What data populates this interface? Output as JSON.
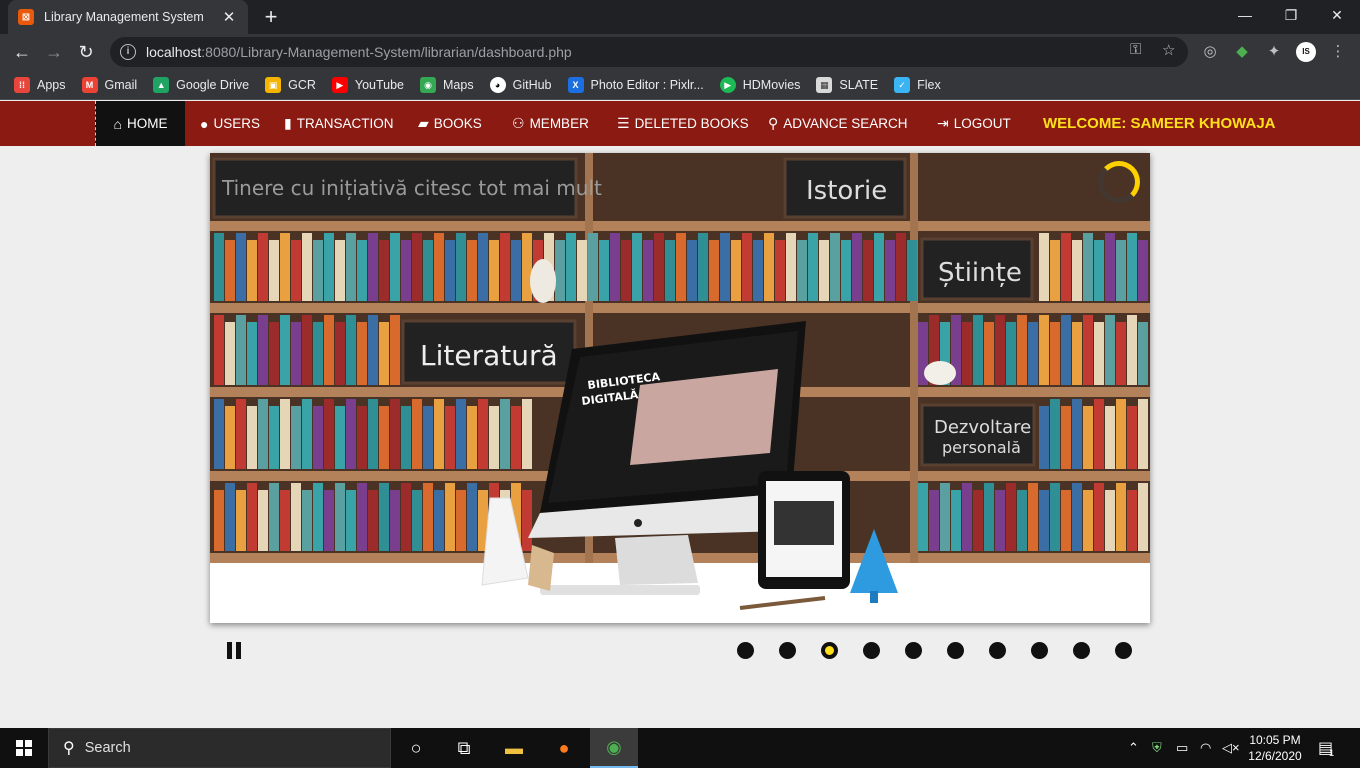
{
  "browser": {
    "tab_title": "Library Management System",
    "tab_close": "✕",
    "new_tab": "+",
    "url_host": "localhost",
    "url_path": ":8080/Library-Management-System/librarian/dashboard.php",
    "window_controls": [
      "—",
      "❐",
      "✕"
    ]
  },
  "bookmarks": [
    {
      "label": "Apps",
      "icon": "apps-grid-icon",
      "color": "#e8453c"
    },
    {
      "label": "Gmail",
      "icon": "gmail-icon",
      "color": "#ea4335"
    },
    {
      "label": "Google Drive",
      "icon": "drive-icon",
      "color": "#1fa463"
    },
    {
      "label": "GCR",
      "icon": "classroom-icon",
      "color": "#f4b400"
    },
    {
      "label": "YouTube",
      "icon": "youtube-icon",
      "color": "#ff0000"
    },
    {
      "label": "Maps",
      "icon": "maps-icon",
      "color": "#34a853"
    },
    {
      "label": "GitHub",
      "icon": "github-icon",
      "color": "#ffffff"
    },
    {
      "label": "Photo Editor : Pixlr...",
      "icon": "pixlr-icon",
      "color": "#1c6fe0"
    },
    {
      "label": "HDMovies",
      "icon": "hdmovies-icon",
      "color": "#1db954"
    },
    {
      "label": "SLATE",
      "icon": "slate-icon",
      "color": "#d9d9d9"
    },
    {
      "label": "Flex",
      "icon": "flex-icon",
      "color": "#3ab4f2"
    }
  ],
  "nav": {
    "home": "HOME",
    "users": "USERS",
    "transaction": "TRANSACTION",
    "books": "BOOKS",
    "member": "MEMBER",
    "deleted_books": "DELETED BOOKS",
    "advance_search": "ADVANCE SEARCH",
    "logout": "LOGOUT",
    "welcome": "WELCOME: SAMEER KHOWAJA"
  },
  "slider": {
    "chalkboards": {
      "top_left": "Tinere cu inițiativă citesc tot mai mult",
      "istorie": "Istorie",
      "stiinte": "Științe",
      "literatura": "Literatură",
      "dezvoltare_1": "Dezvoltare",
      "dezvoltare_2": "personală"
    },
    "screen_text_1": "BIBLIOTECA",
    "screen_text_2": "DIGITALĂ",
    "total_slides": 10,
    "active_slide": 3,
    "loader_progress": 0.25
  },
  "colors": {
    "nav_bg": "#8a1a12",
    "welcome": "#ffe01a",
    "active_dot": "#ffe01a"
  },
  "taskbar": {
    "search_placeholder": "Search",
    "time": "10:05 PM",
    "date": "12/6/2020",
    "notifications": "1"
  }
}
